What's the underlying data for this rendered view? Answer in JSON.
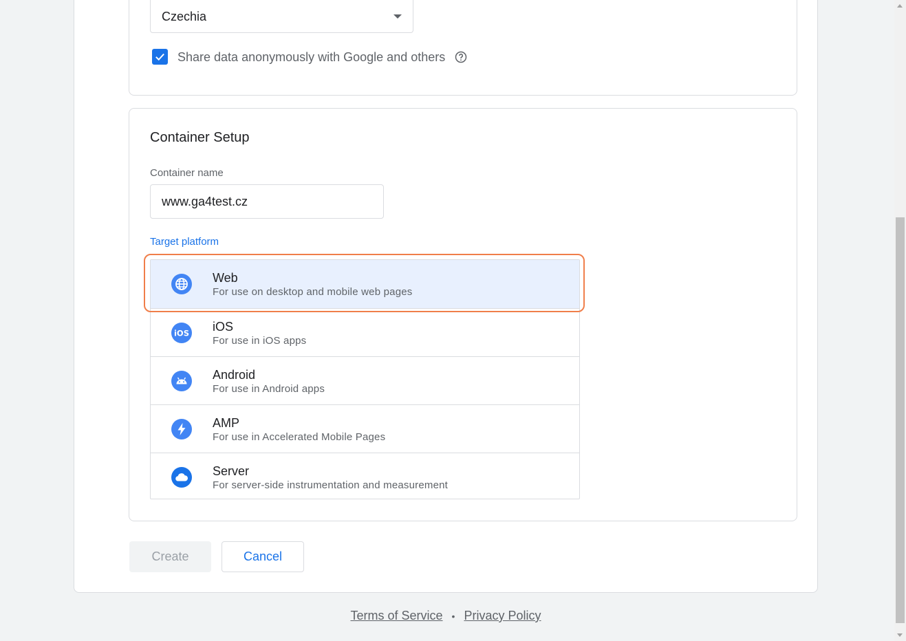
{
  "account": {
    "country": "Czechia",
    "share_data_label": "Share data anonymously with Google and others",
    "share_data_checked": true
  },
  "container": {
    "section_title": "Container Setup",
    "name_label": "Container name",
    "name_value": "www.ga4test.cz",
    "platform_label": "Target platform",
    "platforms": [
      {
        "name": "Web",
        "desc": "For use on desktop and mobile web pages",
        "icon": "globe-icon",
        "selected": true
      },
      {
        "name": "iOS",
        "desc": "For use in iOS apps",
        "icon": "ios-icon",
        "selected": false
      },
      {
        "name": "Android",
        "desc": "For use in Android apps",
        "icon": "android-icon",
        "selected": false
      },
      {
        "name": "AMP",
        "desc": "For use in Accelerated Mobile Pages",
        "icon": "amp-bolt-icon",
        "selected": false
      },
      {
        "name": "Server",
        "desc": "For server-side instrumentation and measurement",
        "icon": "cloud-icon",
        "selected": false
      }
    ]
  },
  "actions": {
    "create_label": "Create",
    "cancel_label": "Cancel"
  },
  "footer": {
    "terms_label": "Terms of Service",
    "separator": "•",
    "privacy_label": "Privacy Policy"
  },
  "colors": {
    "accent": "#1a73e8",
    "highlight": "#f07e4a",
    "selected_bg": "#e8f0fe"
  }
}
